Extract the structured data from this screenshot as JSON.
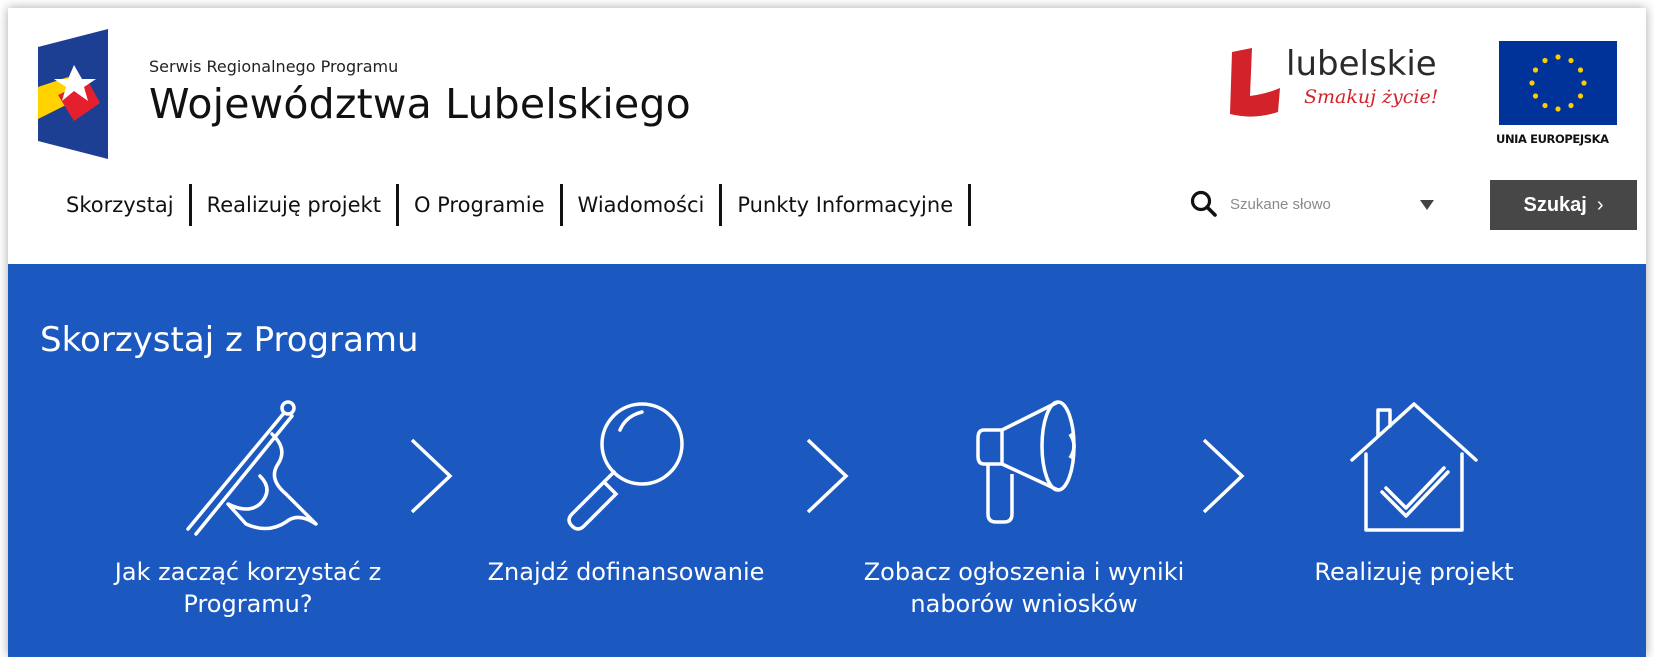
{
  "header": {
    "brand_small": "Serwis Regionalnego Programu",
    "brand_large": "Województwa Lubelskiego",
    "partner_logo_text": "lubelskie",
    "partner_logo_slogan": "Smakuj życie!",
    "eu_label": "UNIA EUROPEJSKA"
  },
  "nav": {
    "items": [
      {
        "label": "Skorzystaj"
      },
      {
        "label": "Realizuję projekt"
      },
      {
        "label": "O Programie"
      },
      {
        "label": "Wiadomości"
      },
      {
        "label": "Punkty Informacyjne"
      }
    ]
  },
  "search": {
    "placeholder": "Szukane słowo",
    "button_label": "Szukaj",
    "button_chevron": "›"
  },
  "hero": {
    "title": "Skorzystaj z Programu",
    "steps": [
      {
        "icon": "flag-icon",
        "label_line1": "Jak zacząć korzystać z",
        "label_line2": "Programu?"
      },
      {
        "icon": "magnifier-icon",
        "label_line1": "Znajdź dofinansowanie",
        "label_line2": ""
      },
      {
        "icon": "megaphone-icon",
        "label_line1": "Zobacz ogłoszenia i wyniki",
        "label_line2": "naborów wniosków"
      },
      {
        "icon": "house-check-icon",
        "label_line1": "Realizuję projekt",
        "label_line2": ""
      }
    ]
  },
  "colors": {
    "hero_background": "#1b58c0",
    "search_button": "#474747",
    "brand_red": "#d2232a",
    "eu_blue": "#003399",
    "eu_yellow": "#ffcc00"
  }
}
